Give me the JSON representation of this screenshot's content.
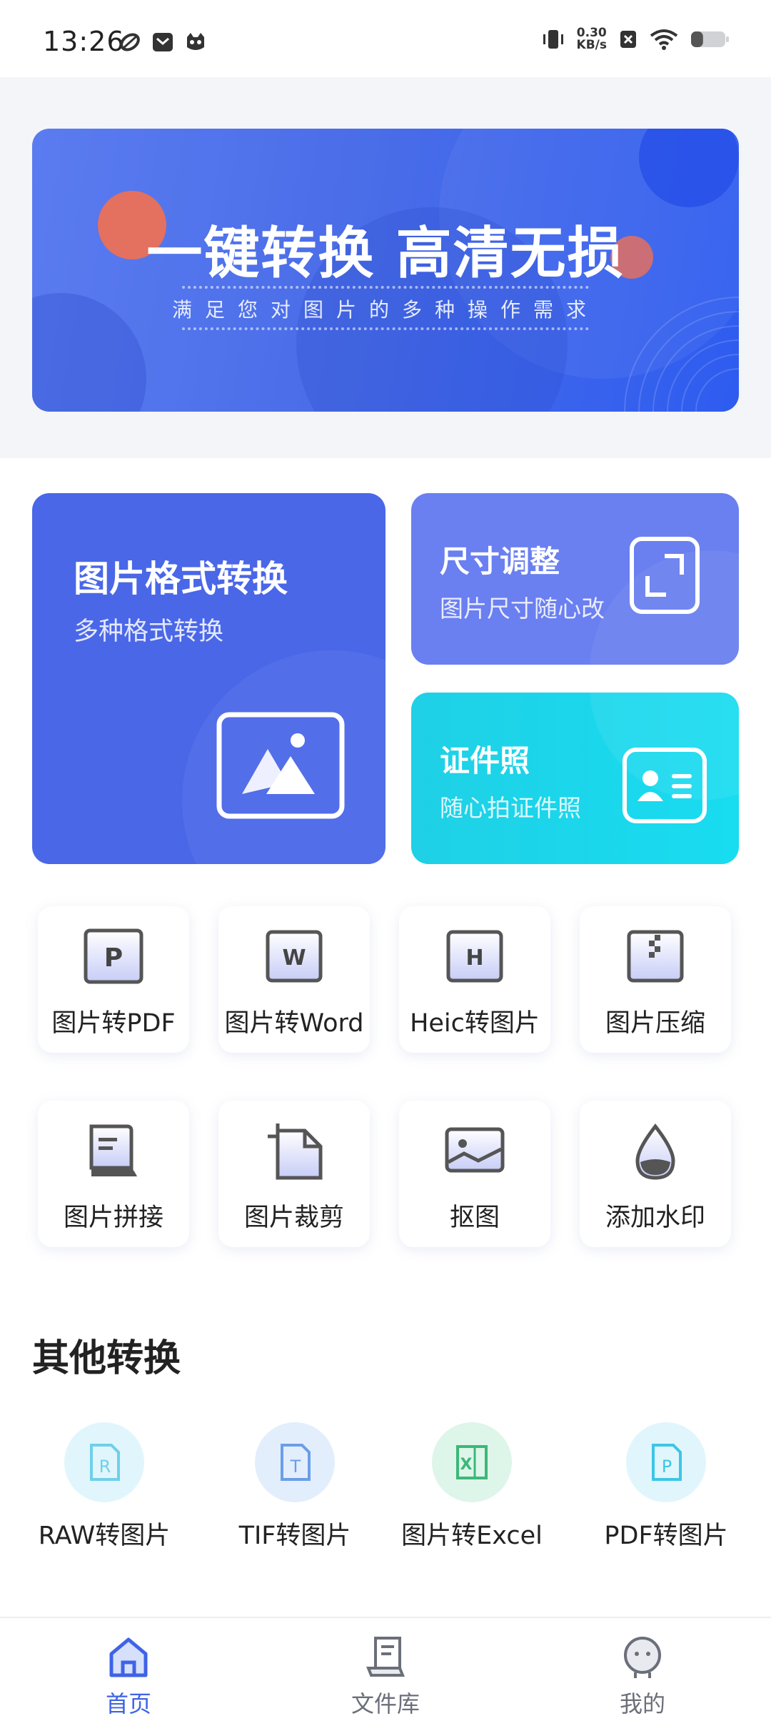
{
  "status_bar": {
    "time": "13:26",
    "net_speed_value": "0.30",
    "net_speed_unit": "KB/s",
    "battery_level": 0.35
  },
  "banner": {
    "title": "一键转换  高清无损",
    "subtitle": "满足您对图片的多种操作需求"
  },
  "features": {
    "format": {
      "title": "图片格式转换",
      "subtitle": "多种格式转换"
    },
    "resize": {
      "title": "尺寸调整",
      "subtitle": "图片尺寸随心改"
    },
    "id_photo": {
      "title": "证件照",
      "subtitle": "随心拍证件照"
    }
  },
  "tools": [
    {
      "label": "图片转PDF",
      "icon": "pdf-doc-icon",
      "glyph": "P"
    },
    {
      "label": "图片转Word",
      "icon": "word-doc-icon",
      "glyph": "W"
    },
    {
      "label": "Heic转图片",
      "icon": "heic-doc-icon",
      "glyph": "H"
    },
    {
      "label": "图片压缩",
      "icon": "compress-icon",
      "glyph": ""
    },
    {
      "label": "图片拼接",
      "icon": "stitch-icon",
      "glyph": ""
    },
    {
      "label": "图片裁剪",
      "icon": "crop-icon",
      "glyph": ""
    },
    {
      "label": "抠图",
      "icon": "cutout-icon",
      "glyph": ""
    },
    {
      "label": "添加水印",
      "icon": "watermark-icon",
      "glyph": ""
    }
  ],
  "other_section": {
    "title": "其他转换",
    "items": [
      {
        "label": "RAW转图片",
        "glyph": "R",
        "icon": "raw-file-icon"
      },
      {
        "label": "TIF转图片",
        "glyph": "T",
        "icon": "tif-file-icon"
      },
      {
        "label": "图片转Excel",
        "glyph": "X",
        "icon": "excel-file-icon"
      },
      {
        "label": "PDF转图片",
        "glyph": "P",
        "icon": "pdf-file-icon"
      }
    ]
  },
  "bottom_nav": {
    "items": [
      {
        "label": "首页",
        "icon": "home-icon",
        "active": true
      },
      {
        "label": "文件库",
        "icon": "file-library-icon",
        "active": false
      },
      {
        "label": "我的",
        "icon": "profile-icon",
        "active": false
      }
    ],
    "active_color": "#3f63e6",
    "inactive_color": "#6b6f7a"
  },
  "colors": {
    "primary": "#4a67e8",
    "resize_card": "#6a7ff0",
    "id_card": "#1fd0e6",
    "page_gray": "#f4f5f9"
  }
}
